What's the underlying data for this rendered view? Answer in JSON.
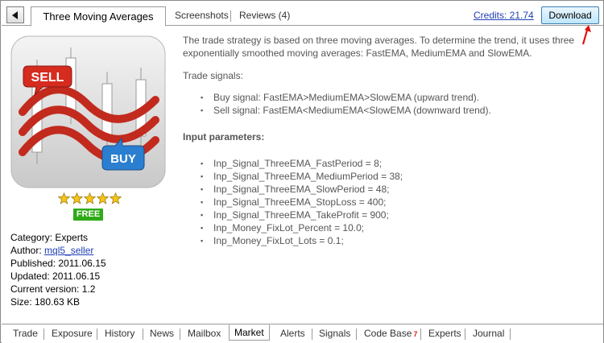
{
  "tabs": {
    "active": "Three Moving Averages",
    "screenshots": "Screenshots",
    "reviews": "Reviews (4)"
  },
  "credits": "Credits: 21.74",
  "download_label": "Download",
  "badge": "FREE",
  "rating": 5,
  "meta": {
    "category": "Category: Experts",
    "author_prefix": "Author: ",
    "author_link": "mql5_seller",
    "published": "Published: 2011.06.15",
    "updated": "Updated: 2011.06.15",
    "version": "Current version: 1.2",
    "size": "Size: 180.63 KB"
  },
  "image_labels": {
    "sell": "SELL",
    "buy": "BUY"
  },
  "content": {
    "description": "The trade strategy is based on three moving averages. To determine the trend, it uses three exponentially smoothed moving averages: FastEMA, MediumEMA and SlowEMA.",
    "signals_title": "Trade signals:",
    "signals": [
      "Buy signal: FastEMA>MediumEMA>SlowEMA (upward trend).",
      "Sell signal: FastEMA<MediumEMA<SlowEMA (downward trend)."
    ],
    "params_title": "Input parameters:",
    "params": [
      "Inp_Signal_ThreeEMA_FastPeriod = 8;",
      "Inp_Signal_ThreeEMA_MediumPeriod = 38;",
      "Inp_Signal_ThreeEMA_SlowPeriod = 48;",
      "Inp_Signal_ThreeEMA_StopLoss = 400;",
      "Inp_Signal_ThreeEMA_TakeProfit = 900;",
      "Inp_Money_FixLot_Percent  = 10.0;",
      "Inp_Money_FixLot_Lots  = 0.1;"
    ]
  },
  "bottom_tabs": [
    "Trade",
    "Exposure",
    "History",
    "News",
    "Mailbox",
    "Market",
    "Alerts",
    "Signals",
    "Code Base",
    "Experts",
    "Journal"
  ],
  "bottom_active": "Market",
  "code_base_badge": "7",
  "colors": {
    "link": "#1f3fb4",
    "badge_green": "#2faa18",
    "sell_red": "#d62b1f",
    "buy_blue": "#2b7fd0"
  }
}
